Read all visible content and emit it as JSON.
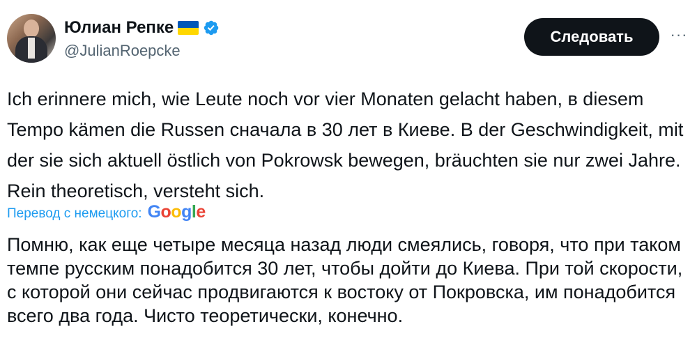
{
  "author": {
    "name": "Юлиан Репке",
    "handle": "@JulianRoepcke",
    "flag_icon": "ukraine-flag-icon",
    "verified_icon": "verified-badge-icon",
    "verified_color": "#1d9bf0"
  },
  "actions": {
    "follow_label": "Следовать",
    "more_label": "···"
  },
  "tweet": {
    "original_text": "Ich erinnere mich, wie Leute noch vor vier Monaten gelacht haben, в diesem Tempo kämen die Russen сначала в 30 лет в Киеве. B der Geschwindigkeit, mit der sie sich aktuell östlich von Pokrowsk bewegen, bräuchten sie nur zwei Jahre. Rein theoretisch, versteht sich.",
    "translation_label": "Перевод с немецкого:",
    "translation_provider": "Google",
    "translated_text": "Помню, как еще четыре месяца назад люди смеялись, говоря, что при таком темпе русским понадобится 30 лет, чтобы дойти до Киева. При той скорости, с которой они сейчас продвигаются к востоку от Покровска, им понадобится всего два года. Чисто теоретически, конечно."
  },
  "colors": {
    "text": "#0f1419",
    "secondary": "#536471",
    "link": "#1d9bf0",
    "button_bg": "#0f1419"
  }
}
